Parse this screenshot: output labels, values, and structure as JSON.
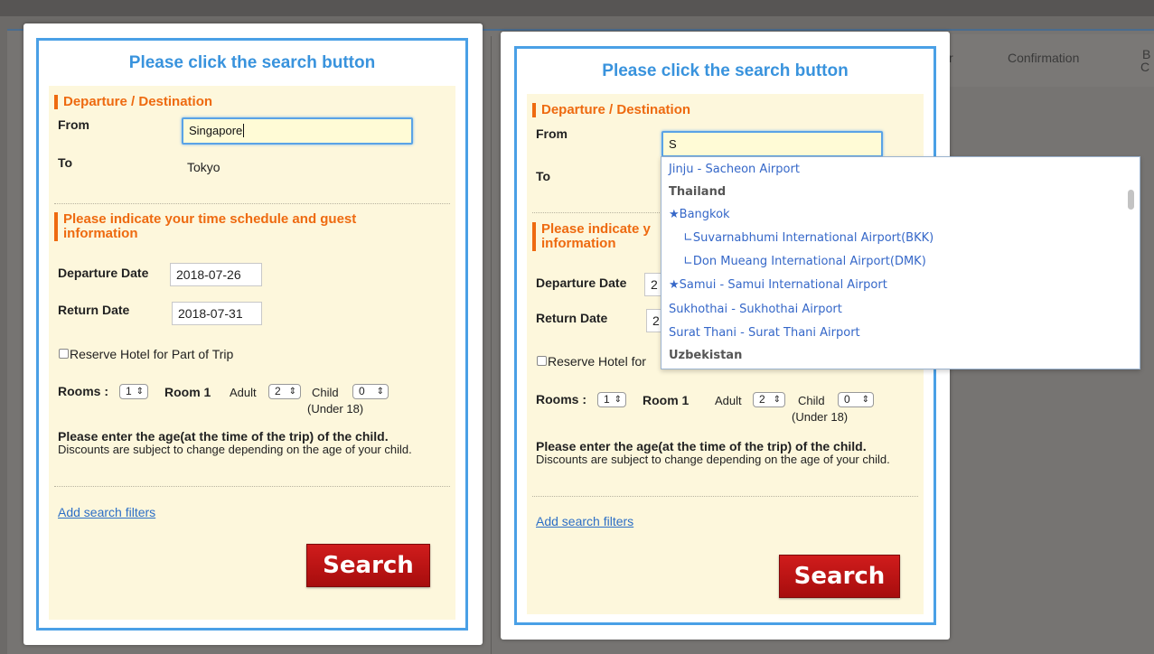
{
  "background": {
    "nav_items": [
      "r",
      "Confirmation",
      "B",
      "C"
    ]
  },
  "panel_left": {
    "title": "Please click the search button",
    "section1": "Departure / Destination",
    "from_label": "From",
    "from_value": "Singapore",
    "to_label": "To",
    "to_value": "Tokyo",
    "section2": "Please indicate your time schedule and guest information",
    "departure_label": "Departure Date",
    "departure_value": "2018-07-26",
    "return_label": "Return Date",
    "return_value": "2018-07-31",
    "reserve_label": "Reserve Hotel for Part of Trip",
    "rooms_label": "Rooms :",
    "rooms_value": "1",
    "room1_label": "Room 1",
    "adult_label": "Adult",
    "adult_value": "2",
    "child_label": "Child",
    "child_value": "0",
    "under18": "(Under 18)",
    "age_heading": "Please enter the age(at the time of the trip) of the child.",
    "age_note": "Discounts are subject to change depending on the age of your child.",
    "filters_link": "Add search filters",
    "search_label": "Search"
  },
  "panel_right": {
    "title": "Please click the search button",
    "section1": "Departure / Destination",
    "from_label": "From",
    "from_value": "S",
    "to_label": "To",
    "section2_line1": "Please indicate y",
    "section2_line2": "information",
    "departure_label": "Departure Date",
    "departure_value": "2",
    "return_label": "Return Date",
    "return_value": "2",
    "reserve_label": "Reserve Hotel for",
    "rooms_label": "Rooms :",
    "rooms_value": "1",
    "room1_label": "Room 1",
    "adult_label": "Adult",
    "adult_value": "2",
    "child_label": "Child",
    "child_value": "0",
    "under18": "(Under 18)",
    "age_heading": "Please enter the age(at the time of the trip) of the child.",
    "age_note": "Discounts are subject to change depending on the age of your child.",
    "filters_link": "Add search filters",
    "search_label": "Search"
  },
  "dropdown": {
    "items": [
      "Jinju - Sacheon Airport",
      "Thailand",
      "★Bangkok",
      "∟Suvarnabhumi International Airport(BKK)",
      "∟Don Mueang International Airport(DMK)",
      "★Samui - Samui International Airport",
      "Sukhothai - Sukhothai Airport",
      "Surat Thani - Surat Thani Airport",
      "Uzbekistan"
    ]
  }
}
